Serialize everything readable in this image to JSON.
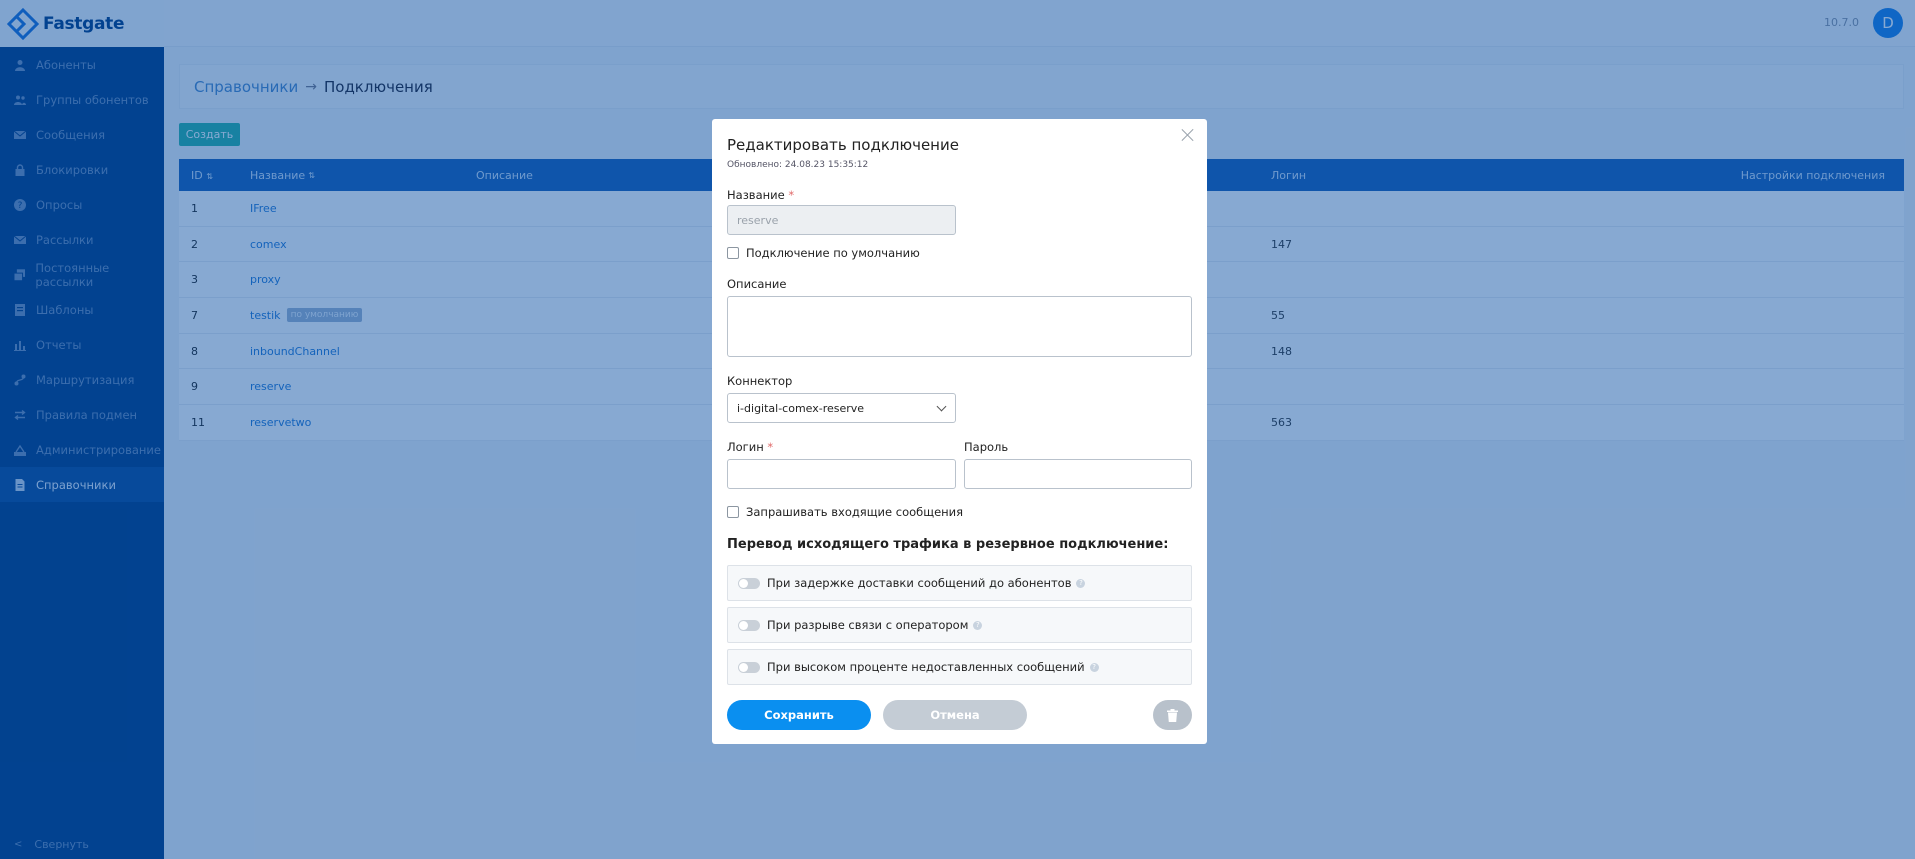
{
  "app": {
    "name": "Fastgate",
    "version": "10.7.0",
    "user_initial": "D"
  },
  "sidebar": {
    "items": [
      {
        "label": "Абоненты",
        "icon": "user-icon"
      },
      {
        "label": "Группы обонентов",
        "icon": "users-icon"
      },
      {
        "label": "Сообщения",
        "icon": "mail-icon"
      },
      {
        "label": "Блокировки",
        "icon": "lock-icon"
      },
      {
        "label": "Опросы",
        "icon": "question-icon"
      },
      {
        "label": "Рассылки",
        "icon": "mail-icon"
      },
      {
        "label": "Постоянные рассылки",
        "icon": "stack-icon"
      },
      {
        "label": "Шаблоны",
        "icon": "template-icon"
      },
      {
        "label": "Отчеты",
        "icon": "chart-icon"
      },
      {
        "label": "Маршрутизация",
        "icon": "route-icon"
      },
      {
        "label": "Правила подмен",
        "icon": "swap-icon"
      },
      {
        "label": "Администрирование",
        "icon": "admin-icon"
      },
      {
        "label": "Справочники",
        "icon": "document-icon",
        "active": true
      }
    ],
    "collapse_label": "Свернуть"
  },
  "breadcrumb": {
    "first": "Справочники",
    "second": "Подключения"
  },
  "create_label": "Создать",
  "table": {
    "headers": {
      "id": "ID",
      "name": "Название",
      "description": "Описание",
      "login": "Логин",
      "settings": "Настройки подключения"
    },
    "rows": [
      {
        "id": "1",
        "name": "IFree",
        "login": ""
      },
      {
        "id": "2",
        "name": "comex",
        "login": "147"
      },
      {
        "id": "3",
        "name": "proxy",
        "login": ""
      },
      {
        "id": "7",
        "name": "testik",
        "badge": "по умолчанию",
        "login": "55"
      },
      {
        "id": "8",
        "name": "inboundChannel",
        "login": "148"
      },
      {
        "id": "9",
        "name": "reserve",
        "login": ""
      },
      {
        "id": "11",
        "name": "reservetwo",
        "login": "563"
      }
    ]
  },
  "modal": {
    "title": "Редактировать подключение",
    "updated": "Обновлено: 24.08.23 15:35:12",
    "name_label": "Название",
    "name_value": "reserve",
    "default_label": "Подключение по умолчанию",
    "description_label": "Описание",
    "connector_label": "Коннектор",
    "connector_value": "i-digital-comex-reserve",
    "login_label": "Логин",
    "password_label": "Пароль",
    "incoming_label": "Запрашивать входящие сообщения",
    "section_title": "Перевод исходящего трафика в резервное подключение:",
    "toggles": [
      "При задержке доставки сообщений до абонентов",
      "При разрыве связи с оператором",
      "При высоком проценте недоставленных сообщений"
    ],
    "save_label": "Сохранить",
    "cancel_label": "Отмена"
  }
}
